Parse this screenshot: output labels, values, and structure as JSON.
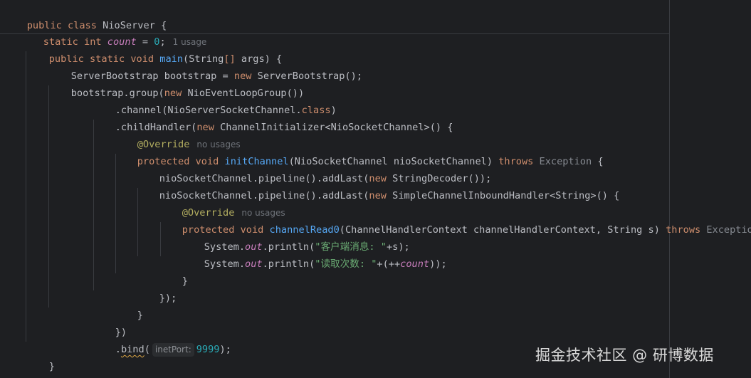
{
  "editor": {
    "class_decl": {
      "kw_public": "public",
      "kw_class": "class",
      "name": "NioServer",
      "open": " {"
    },
    "field": {
      "kw_static": "static",
      "kw_int": "int",
      "name": "count",
      "assign": " = ",
      "value": "0",
      "end": ";",
      "usage_hint": "1 usage"
    },
    "main_decl": {
      "kw_public": "public",
      "kw_static": "static",
      "kw_void": "void",
      "name": "main",
      "params": "(String",
      "brackets": "[]",
      "args": " args) {"
    },
    "bootstrap_decl": {
      "type_var": "ServerBootstrap bootstrap = ",
      "kw_new": "new",
      "ctor": " ServerBootstrap();"
    },
    "group_call": {
      "prefix": "bootstrap.group(",
      "kw_new": "new",
      "rest": " NioEventLoopGroup())"
    },
    "channel_call": {
      "prefix": ".channel(NioServerSocketChannel.",
      "kw_class": "class",
      "end": ")"
    },
    "child_handler": {
      "prefix": ".childHandler(",
      "kw_new": "new",
      "rest": " ChannelInitializer<NioSocketChannel>() {"
    },
    "override_1": {
      "annotation": "@Override",
      "usage_hint": "no usages"
    },
    "init_channel": {
      "kw_protected": "protected",
      "kw_void": "void",
      "name": "initChannel",
      "params": "(NioSocketChannel nioSocketChannel) ",
      "kw_throws": "throws",
      "exception": "Exception",
      "open": " {"
    },
    "pipeline_1": {
      "prefix": "nioSocketChannel.pipeline().addLast(",
      "kw_new": "new",
      "rest": " StringDecoder());"
    },
    "pipeline_2": {
      "prefix": "nioSocketChannel.pipeline().addLast(",
      "kw_new": "new",
      "rest": " SimpleChannelInboundHandler<String>() {"
    },
    "override_2": {
      "annotation": "@Override",
      "usage_hint": "no usages"
    },
    "channel_read": {
      "kw_protected": "protected",
      "kw_void": "void",
      "name": "channelRead0",
      "params": "(ChannelHandlerContext channelHandlerContext, String s) ",
      "kw_throws": "throws",
      "exception": "Exception",
      "open": " {"
    },
    "println_1": {
      "prefix": "System.",
      "out": "out",
      "call": ".println(",
      "string": "\"客户端消息: \"",
      "rest": "+s);"
    },
    "println_2": {
      "prefix": "System.",
      "out": "out",
      "call": ".println(",
      "string": "\"读取次数: \"",
      "mid": "+(++",
      "field": "count",
      "rest": "));"
    },
    "close_brace_1": "}",
    "close_anon_1": "});",
    "close_brace_2": "}",
    "close_paren": "})",
    "bind_call": {
      "prefix": ".",
      "name": "bind",
      "open": "(",
      "param_hint": "inetPort:",
      "value": "9999",
      "end": ");"
    },
    "close_main": "}",
    "close_class": "}"
  },
  "watermark": {
    "text": "掘金技术社区 @ 研博数据"
  },
  "colors": {
    "background": "#1e1f22",
    "keyword": "#cf8e6d",
    "number": "#2aacb8",
    "string": "#6aab73",
    "annotation": "#b3ae60",
    "method_decl": "#56a8f5",
    "static_field": "#c77dbb",
    "default_text": "#bcbec4",
    "hint": "#6f737a"
  }
}
